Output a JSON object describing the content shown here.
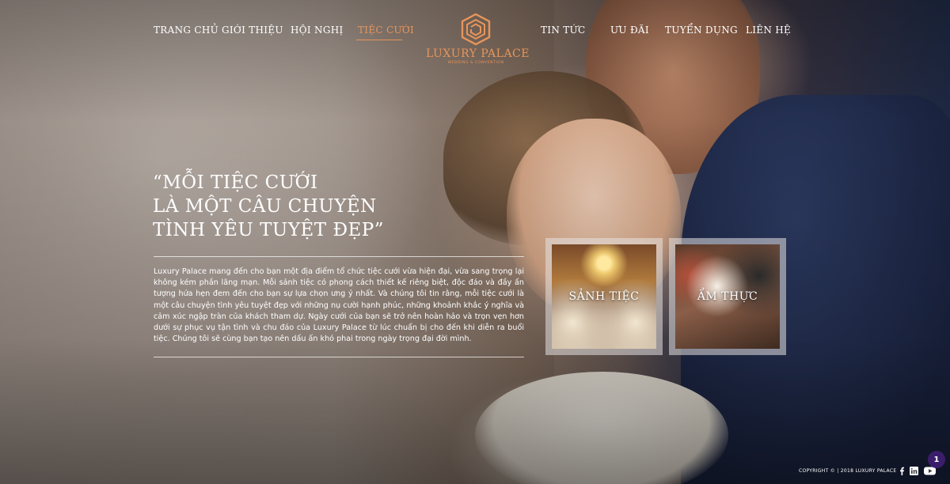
{
  "nav": {
    "items": [
      {
        "label": "TRANG CHỦ"
      },
      {
        "label": "GIỚI THIỆU"
      },
      {
        "label": "HỘI NGHỊ"
      },
      {
        "label": "TIỆC CƯỚI"
      },
      {
        "label": "TIN TỨC"
      },
      {
        "label": "ƯU ĐÃI"
      },
      {
        "label": "TUYỂN DỤNG"
      },
      {
        "label": "LIÊN HỆ"
      }
    ],
    "active_index": 3,
    "active_color": "#e8955a"
  },
  "logo": {
    "name": "LUXURY PALACE",
    "tagline": "WEDDING & CONVENTION",
    "color": "#e8955a",
    "icon": "hexagon-logo-icon"
  },
  "hero": {
    "quote_lines": [
      "“MỖI TIỆC CƯỚI",
      "LÀ MỘT CÂU CHUYỆN",
      "TÌNH YÊU TUYỆT ĐẸP”"
    ],
    "description": "Luxury Palace mang đến cho bạn một địa điểm tổ chức tiệc cưới vừa hiện đại, vừa sang trọng lại không kém phần lãng mạn. Mỗi sảnh tiệc có phong cách thiết kế riêng biệt, độc đáo và đầy ấn tượng hứa hẹn đem đến cho bạn sự lựa chọn ưng ý nhất. Và chúng tôi tin rằng, mỗi tiệc cưới là một câu chuyện tình yêu tuyệt đẹp với những nụ cười hạnh phúc, những khoảnh khắc ý nghĩa và cảm xúc ngập tràn của khách tham dự. Ngày cưới của bạn sẽ trở nên hoàn hảo và trọn vẹn hơn dưới sự phục vụ tận tình và chu đáo của Luxury Palace từ lúc chuẩn bị cho đến khi diễn ra buổi tiệc. Chúng tôi sẽ cùng bạn tạo nên dấu ấn khó phai trong ngày trọng đại đời mình."
  },
  "cards": [
    {
      "label": "SẢNH TIỆC"
    },
    {
      "label": "ẨM THỰC"
    }
  ],
  "footer": {
    "copyright": "COPYRIGHT © | 2018 LUXURY PALACE",
    "social_icons": [
      "facebook-icon",
      "linkedin-icon",
      "youtube-icon"
    ]
  },
  "notification": {
    "count": "1",
    "color": "#3b1e6b"
  }
}
